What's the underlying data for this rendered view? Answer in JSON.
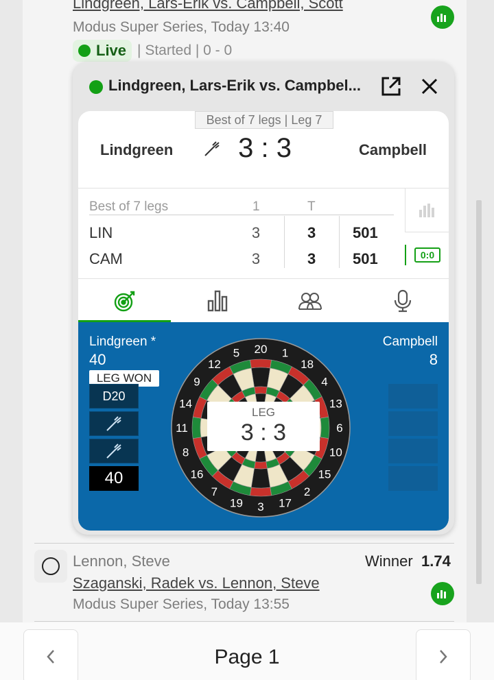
{
  "event_top": {
    "title": "Lindgreen, Lars-Erik vs. Campbell, Scott",
    "subtitle": "Modus Super Series, Today 13:40",
    "live_label": "Live",
    "status": "| Started | 0 - 0",
    "stats_icon": "bar-chart-icon"
  },
  "popup": {
    "title": "Lindgreen, Lars-Erik vs. Campbel...",
    "open_icon": "external-link-icon",
    "close_icon": "close-icon",
    "best_of_tag": "Best of 7 legs | Leg 7",
    "player_left": "Lindgreen",
    "player_right": "Campbell",
    "score_left": "3",
    "score_sep": ":",
    "score_right": "3",
    "table": {
      "header": "Best of 7 legs",
      "col_set": "1",
      "col_total": "T",
      "rows": [
        {
          "name": "LIN",
          "set": "3",
          "total": "3",
          "remaining": "501"
        },
        {
          "name": "CAM",
          "set": "3",
          "total": "3",
          "remaining": "501"
        }
      ]
    },
    "side_zero": "0:0",
    "tabs": [
      "target-icon",
      "stats-icon",
      "players-icon",
      "microphone-icon"
    ],
    "board": {
      "left_name": "Lindgreen *",
      "left_score": "40",
      "right_name": "Campbell",
      "right_score": "8",
      "leg_won": "LEG WON",
      "throws": [
        "D20",
        "",
        ""
      ],
      "throw_total": "40",
      "leg_label": "LEG",
      "leg_score": "3 : 3",
      "numbers": [
        "20",
        "1",
        "18",
        "4",
        "13",
        "6",
        "10",
        "15",
        "2",
        "17",
        "3",
        "19",
        "7",
        "16",
        "8",
        "11",
        "14",
        "9",
        "12",
        "5"
      ]
    }
  },
  "event_bottom": {
    "selection": "Lennon, Steve",
    "market": "Winner",
    "odds": "1.74",
    "title": "Szaganski, Radek vs. Lennon, Steve",
    "subtitle": "Modus Super Series, Today 13:55"
  },
  "pager": {
    "label": "Page 1",
    "prev_icon": "chevron-left-icon",
    "next_icon": "chevron-right-icon"
  },
  "colors": {
    "live_green": "#13a015",
    "board_blue": "#0b68a9"
  }
}
